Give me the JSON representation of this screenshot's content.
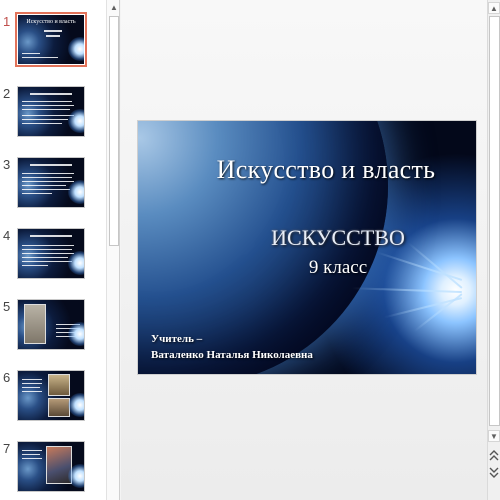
{
  "slides": [
    {
      "number": "1",
      "active": true
    },
    {
      "number": "2",
      "active": false
    },
    {
      "number": "3",
      "active": false
    },
    {
      "number": "4",
      "active": false
    },
    {
      "number": "5",
      "active": false
    },
    {
      "number": "6",
      "active": false
    },
    {
      "number": "7",
      "active": false
    }
  ],
  "current_slide": {
    "title": "Искусство и власть",
    "subject": "ИСКУССТВО",
    "grade": "9 класс",
    "teacher_label": "Учитель –",
    "teacher_name": "Ваталенко Наталья Николаевна"
  },
  "scrollbar": {
    "up_icon": "triangle-up-icon",
    "down_icon": "triangle-down-icon",
    "prev_slide_icon": "double-chevron-up-icon",
    "next_slide_icon": "double-chevron-down-icon"
  },
  "colors": {
    "selected_thumb_border": "#e2735a",
    "selected_number": "#c0504d",
    "slide_background": "#03081a"
  }
}
